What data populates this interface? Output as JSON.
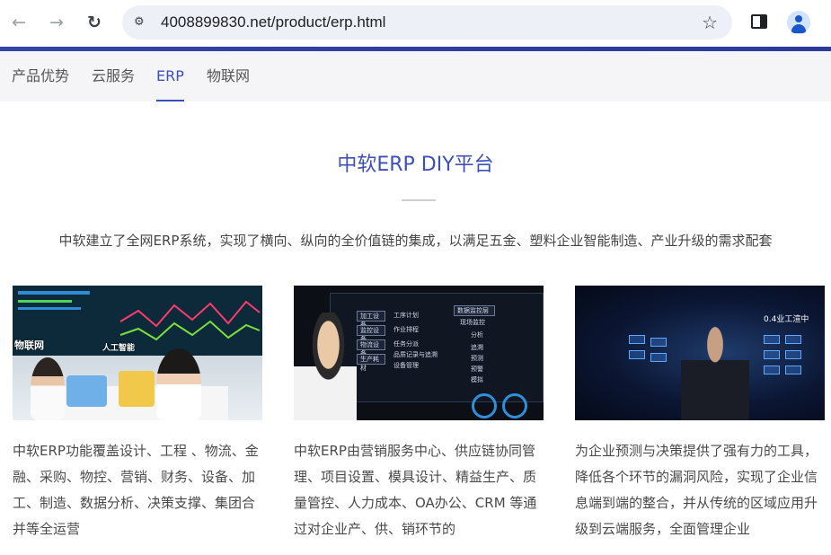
{
  "browser": {
    "url": "4008899830.net/product/erp.html",
    "icons": [
      "back-arrow-icon",
      "forward-arrow-icon",
      "reload-icon",
      "site-info-icon",
      "bookmark-star-icon",
      "side-panel-icon",
      "profile-icon"
    ]
  },
  "tabs": [
    {
      "label": "产品优势"
    },
    {
      "label": "云服务"
    },
    {
      "label": "ERP"
    },
    {
      "label": "物联网"
    }
  ],
  "active_tab": "ERP",
  "main": {
    "title": "中软ERP DIY平台",
    "subtitle": "中软建立了全网ERP系统，实现了横向、纵向的全价值链的集成，以满足五金、塑料企业智能制造、产业升级的需求配套"
  },
  "cards": [
    {
      "image_text": [
        "物联网",
        "人工智能"
      ],
      "description": "中软ERP功能覆盖设计、工程 、物流、金融、采购、物控、营销、财务、设备、加工、制造、数据分析、决策支撑、集团合并等全运营"
    },
    {
      "image_text": [
        "加工设备",
        "工序计划",
        "监控设备",
        "作业排程",
        "物流设备",
        "任务分派",
        "生产耗材",
        "品质记录与追溯",
        "设备管理",
        "数据监控层",
        "现场监控",
        "分析",
        "追溯",
        "预测",
        "预警",
        "模拟"
      ],
      "description": "中软ERP由营销服务中心、供应链协同管理、项目设置、模具设计、精益生产、质量管控、人力成本、OA办公、CRM 等通过对企业产、供、销环节的"
    },
    {
      "image_text": [
        "0.4业工渲中"
      ],
      "description": "为企业预测与决策提供了强有力的工具，降低各个环节的漏洞风险，实现了企业信息端到端的整合，并从传统的区域应用升级到云端服务，全面管理企业"
    }
  ],
  "colors": {
    "brand": "#3d4fb8",
    "tabbar_bg": "#f5f5f7",
    "loadbar": "#3545a6"
  }
}
